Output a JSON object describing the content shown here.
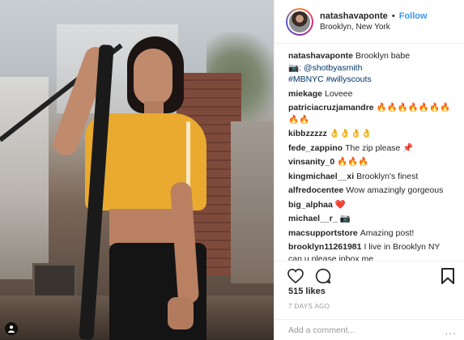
{
  "post": {
    "username": "natashavaponte",
    "separator": "•",
    "follow_label": "Follow",
    "location": "Brooklyn, New York",
    "caption": {
      "username": "natashavaponte",
      "text": "Brooklyn babe",
      "camera_emoji": "📷",
      "mention": "@shotbyasmith",
      "hashtags": "#MBNYC #willyscouts"
    },
    "likes": "515 likes",
    "time_ago": "7 DAYS AGO",
    "add_comment_placeholder": "Add a comment...",
    "more_icon": "..."
  },
  "comments": [
    {
      "user": "miekage",
      "text": "Loveee"
    },
    {
      "user": "patriciacruzjamandre",
      "text": "🔥🔥🔥🔥🔥🔥🔥🔥🔥"
    },
    {
      "user": "kibbzzzzz",
      "text": "👌👌👌👌"
    },
    {
      "user": "fede_zappino",
      "text": "The zip please 📌"
    },
    {
      "user": "vinsanity_0",
      "text": "🔥🔥🔥"
    },
    {
      "user": "kingmichael__xi",
      "text": "Brooklyn's finest"
    },
    {
      "user": "alfredocentee",
      "text": "Wow amazingly gorgeous"
    },
    {
      "user": "big_alphaa",
      "text": "❤️"
    },
    {
      "user": "michael__r_",
      "text": "📷"
    },
    {
      "user": "macsupportstore",
      "text": "Amazing post!"
    },
    {
      "user": "brooklyn11261981",
      "text": "I live in Brooklyn NY can u please inbox me"
    }
  ],
  "icons": {
    "like": "heart-icon",
    "comment": "comment-icon",
    "save": "bookmark-icon",
    "tag": "user-tag-icon"
  },
  "colors": {
    "follow": "#3897f0",
    "text": "#262626",
    "muted": "#999999"
  }
}
